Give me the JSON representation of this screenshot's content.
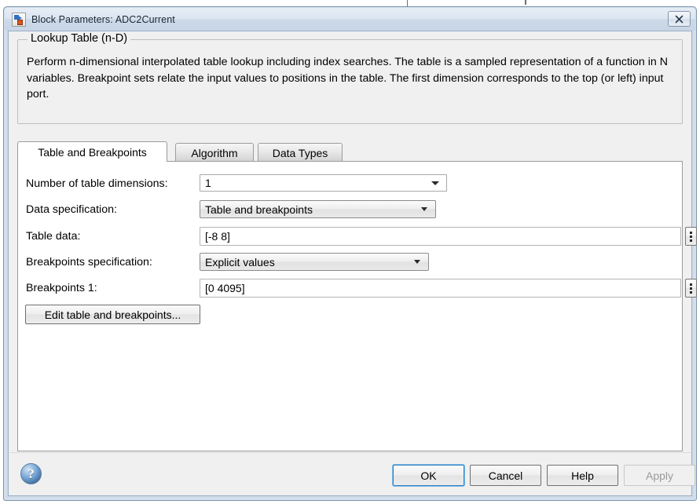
{
  "window": {
    "title": "Block Parameters: ADC2Current",
    "icon": "simulink-block-icon",
    "close_label": "✕"
  },
  "description": {
    "group_title": "Lookup Table (n-D)",
    "body": "Perform n-dimensional interpolated table lookup including index searches. The table is a sampled representation of a function in N variables. Breakpoint sets relate the input values to positions in the table. The first dimension corresponds to the top (or left) input port."
  },
  "tabs": [
    {
      "label": "Table and Breakpoints",
      "active": true
    },
    {
      "label": "Algorithm",
      "active": false
    },
    {
      "label": "Data Types",
      "active": false
    }
  ],
  "form": {
    "number_of_table_dimensions": {
      "label": "Number of table dimensions:",
      "value": "1",
      "control": "editable-combobox"
    },
    "data_specification": {
      "label": "Data specification:",
      "value": "Table and breakpoints",
      "control": "combobox"
    },
    "table_data": {
      "label": "Table data:",
      "value": "[-8 8]",
      "control": "textfield",
      "aux_button": "vertical-ellipsis"
    },
    "breakpoints_specification": {
      "label": "Breakpoints specification:",
      "value": "Explicit values",
      "control": "combobox"
    },
    "breakpoints_1": {
      "label": "Breakpoints 1:",
      "value": "[0 4095]",
      "control": "textfield",
      "aux_button": "vertical-ellipsis"
    },
    "edit_button": {
      "label": "Edit table and breakpoints..."
    }
  },
  "footer": {
    "help_icon": "question-mark-icon",
    "buttons": [
      {
        "label": "OK",
        "state": "default"
      },
      {
        "label": "Cancel",
        "state": "normal"
      },
      {
        "label": "Help",
        "state": "normal"
      },
      {
        "label": "Apply",
        "state": "disabled"
      }
    ]
  },
  "colors": {
    "accent": "#2f7fc4",
    "titlebar": "#d4e0ee",
    "dialog_bg": "#f0f0f0",
    "panel_bg": "#ffffff"
  }
}
